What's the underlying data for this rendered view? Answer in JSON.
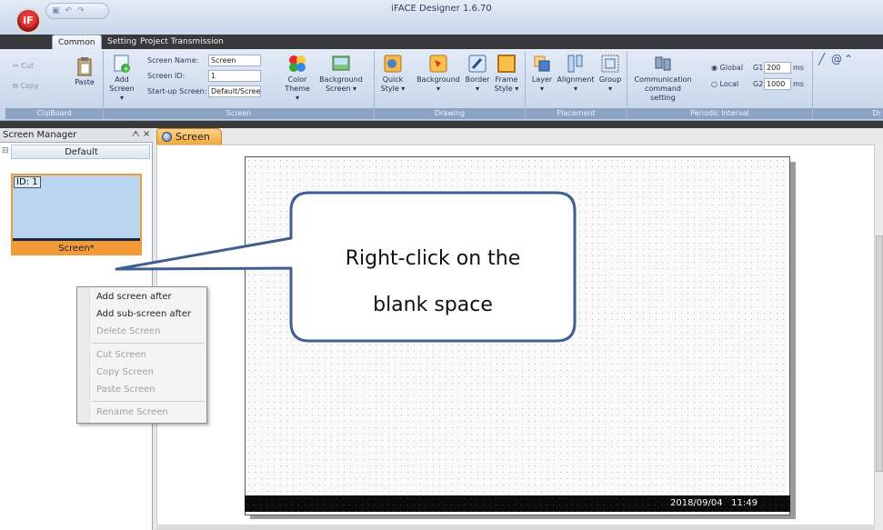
{
  "app": {
    "title": "iFACE Designer 1.6.70",
    "orb_label": "iF",
    "qat_icons": [
      "save-icon",
      "undo-icon",
      "redo-icon"
    ]
  },
  "ribbon_tabs": [
    "Common",
    "Setting",
    "Project Transmission"
  ],
  "clipboard": {
    "cut": "Cut",
    "copy": "Copy",
    "paste": "Paste",
    "group": "ClipBoard"
  },
  "screen_group": {
    "add": "Add\nScreen",
    "add_l1": "Add",
    "add_l2": "Screen ▾",
    "name_label": "Screen Name:",
    "name_value": "Screen",
    "id_label": "Screen ID:",
    "id_value": "1",
    "startup_label": "Start-up Screen:",
    "startup_value": "Default/Scree",
    "color_theme_l1": "Color",
    "color_theme_l2": "Theme ▾",
    "bg_screen_l1": "Background",
    "bg_screen_l2": "Screen ▾",
    "group": "Screen"
  },
  "drawing": {
    "quick_l1": "Quick",
    "quick_l2": "Style ▾",
    "background": "Background",
    "border": "Border",
    "frame_l1": "Frame",
    "frame_l2": "Style ▾",
    "group": "Drawing"
  },
  "placement": {
    "layer": "Layer",
    "alignment": "Alignment",
    "group_btn": "Group",
    "group": "Placement"
  },
  "periodic": {
    "comm_l1": "Communication",
    "comm_l2": "command setting",
    "global": "Global",
    "local": "Local",
    "g1_label": "G1",
    "g1_value": "200",
    "g2_label": "G2",
    "g2_value": "1000",
    "unit": "ms",
    "group": "Periodic Interval"
  },
  "draw_tools": {
    "group": "Dr"
  },
  "screen_manager": {
    "title": "Screen Manager",
    "pin": "ᗅ",
    "close": "×",
    "collapse": "⊟",
    "group_name": "Default",
    "thumb_id": "ID: 1",
    "thumb_label": "Screen*"
  },
  "context_menu": {
    "items": [
      "Add screen after",
      "Add sub-screen after",
      "Delete Screen",
      "Cut Screen",
      "Copy Screen",
      "Paste Screen",
      "Rename Screen"
    ]
  },
  "editor": {
    "tab": "Screen",
    "clock_date": "2018/09/04",
    "clock_time": "11:49"
  },
  "callout": {
    "line1": "Right-click on the",
    "line2": "blank space",
    "color": "#3f5f8f"
  },
  "colors": {
    "accent_orange": "#f29a3a",
    "ribbon_label": "#8da3c4"
  }
}
